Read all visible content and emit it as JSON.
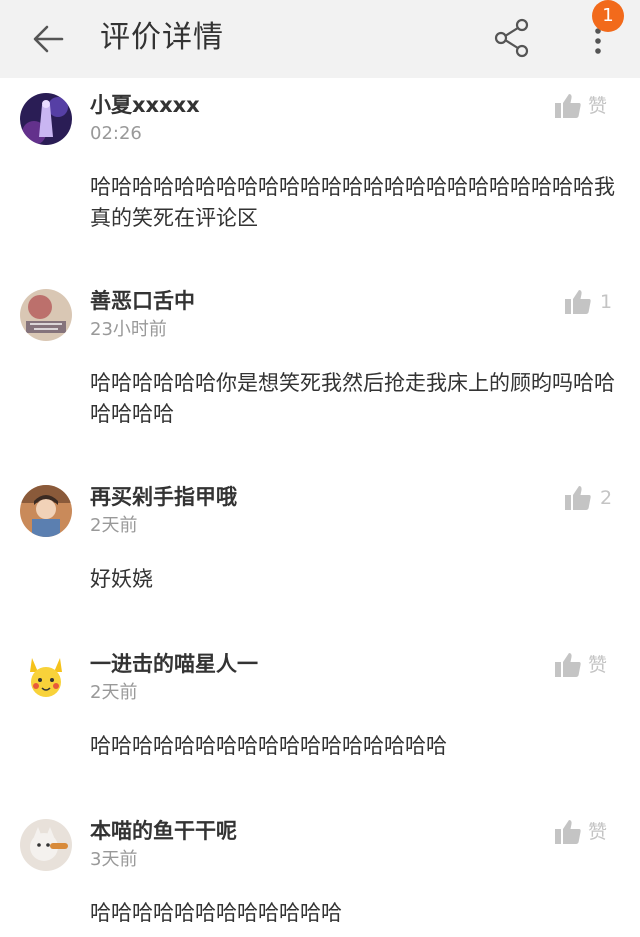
{
  "header": {
    "title": "评价详情",
    "back_icon": "back-arrow-icon",
    "share_icon": "share-icon",
    "more_icon": "more-vertical-icon",
    "notification_badge": "1",
    "badge_color": "#f26a1b"
  },
  "comments": [
    {
      "username": "小夏xxxxx",
      "time": "02:26",
      "text": "哈哈哈哈哈哈哈哈哈哈哈哈哈哈哈哈哈哈哈哈哈哈哈哈我真的笑死在评论区",
      "like_label": "赞"
    },
    {
      "username": "善恶口舌中",
      "time": "23小时前",
      "text": "哈哈哈哈哈哈你是想笑死我然后抢走我床上的顾昀吗哈哈哈哈哈哈",
      "like_label": "1"
    },
    {
      "username": "再买剁手指甲哦",
      "time": "2天前",
      "text": "好妖娆",
      "like_label": "2"
    },
    {
      "username": "一进击的喵星人一",
      "time": "2天前",
      "text": "哈哈哈哈哈哈哈哈哈哈哈哈哈哈哈哈哈",
      "like_label": "赞"
    },
    {
      "username": "本喵的鱼干干呢",
      "time": "3天前",
      "text": "哈哈哈哈哈哈哈哈哈哈哈哈",
      "like_label": "赞"
    }
  ]
}
